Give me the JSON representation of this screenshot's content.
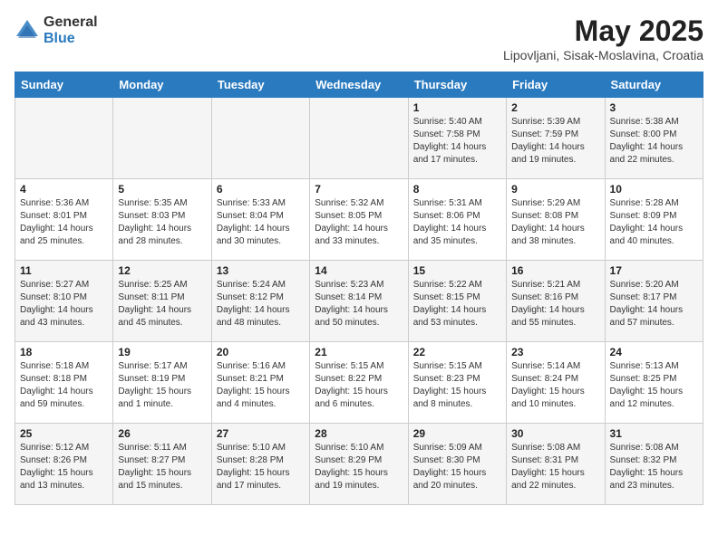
{
  "logo": {
    "general": "General",
    "blue": "Blue"
  },
  "title": "May 2025",
  "subtitle": "Lipovljani, Sisak-Moslavina, Croatia",
  "days_header": [
    "Sunday",
    "Monday",
    "Tuesday",
    "Wednesday",
    "Thursday",
    "Friday",
    "Saturday"
  ],
  "weeks": [
    [
      {
        "num": "",
        "info": ""
      },
      {
        "num": "",
        "info": ""
      },
      {
        "num": "",
        "info": ""
      },
      {
        "num": "",
        "info": ""
      },
      {
        "num": "1",
        "info": "Sunrise: 5:40 AM\nSunset: 7:58 PM\nDaylight: 14 hours\nand 17 minutes."
      },
      {
        "num": "2",
        "info": "Sunrise: 5:39 AM\nSunset: 7:59 PM\nDaylight: 14 hours\nand 19 minutes."
      },
      {
        "num": "3",
        "info": "Sunrise: 5:38 AM\nSunset: 8:00 PM\nDaylight: 14 hours\nand 22 minutes."
      }
    ],
    [
      {
        "num": "4",
        "info": "Sunrise: 5:36 AM\nSunset: 8:01 PM\nDaylight: 14 hours\nand 25 minutes."
      },
      {
        "num": "5",
        "info": "Sunrise: 5:35 AM\nSunset: 8:03 PM\nDaylight: 14 hours\nand 28 minutes."
      },
      {
        "num": "6",
        "info": "Sunrise: 5:33 AM\nSunset: 8:04 PM\nDaylight: 14 hours\nand 30 minutes."
      },
      {
        "num": "7",
        "info": "Sunrise: 5:32 AM\nSunset: 8:05 PM\nDaylight: 14 hours\nand 33 minutes."
      },
      {
        "num": "8",
        "info": "Sunrise: 5:31 AM\nSunset: 8:06 PM\nDaylight: 14 hours\nand 35 minutes."
      },
      {
        "num": "9",
        "info": "Sunrise: 5:29 AM\nSunset: 8:08 PM\nDaylight: 14 hours\nand 38 minutes."
      },
      {
        "num": "10",
        "info": "Sunrise: 5:28 AM\nSunset: 8:09 PM\nDaylight: 14 hours\nand 40 minutes."
      }
    ],
    [
      {
        "num": "11",
        "info": "Sunrise: 5:27 AM\nSunset: 8:10 PM\nDaylight: 14 hours\nand 43 minutes."
      },
      {
        "num": "12",
        "info": "Sunrise: 5:25 AM\nSunset: 8:11 PM\nDaylight: 14 hours\nand 45 minutes."
      },
      {
        "num": "13",
        "info": "Sunrise: 5:24 AM\nSunset: 8:12 PM\nDaylight: 14 hours\nand 48 minutes."
      },
      {
        "num": "14",
        "info": "Sunrise: 5:23 AM\nSunset: 8:14 PM\nDaylight: 14 hours\nand 50 minutes."
      },
      {
        "num": "15",
        "info": "Sunrise: 5:22 AM\nSunset: 8:15 PM\nDaylight: 14 hours\nand 53 minutes."
      },
      {
        "num": "16",
        "info": "Sunrise: 5:21 AM\nSunset: 8:16 PM\nDaylight: 14 hours\nand 55 minutes."
      },
      {
        "num": "17",
        "info": "Sunrise: 5:20 AM\nSunset: 8:17 PM\nDaylight: 14 hours\nand 57 minutes."
      }
    ],
    [
      {
        "num": "18",
        "info": "Sunrise: 5:18 AM\nSunset: 8:18 PM\nDaylight: 14 hours\nand 59 minutes."
      },
      {
        "num": "19",
        "info": "Sunrise: 5:17 AM\nSunset: 8:19 PM\nDaylight: 15 hours\nand 1 minute."
      },
      {
        "num": "20",
        "info": "Sunrise: 5:16 AM\nSunset: 8:21 PM\nDaylight: 15 hours\nand 4 minutes."
      },
      {
        "num": "21",
        "info": "Sunrise: 5:15 AM\nSunset: 8:22 PM\nDaylight: 15 hours\nand 6 minutes."
      },
      {
        "num": "22",
        "info": "Sunrise: 5:15 AM\nSunset: 8:23 PM\nDaylight: 15 hours\nand 8 minutes."
      },
      {
        "num": "23",
        "info": "Sunrise: 5:14 AM\nSunset: 8:24 PM\nDaylight: 15 hours\nand 10 minutes."
      },
      {
        "num": "24",
        "info": "Sunrise: 5:13 AM\nSunset: 8:25 PM\nDaylight: 15 hours\nand 12 minutes."
      }
    ],
    [
      {
        "num": "25",
        "info": "Sunrise: 5:12 AM\nSunset: 8:26 PM\nDaylight: 15 hours\nand 13 minutes."
      },
      {
        "num": "26",
        "info": "Sunrise: 5:11 AM\nSunset: 8:27 PM\nDaylight: 15 hours\nand 15 minutes."
      },
      {
        "num": "27",
        "info": "Sunrise: 5:10 AM\nSunset: 8:28 PM\nDaylight: 15 hours\nand 17 minutes."
      },
      {
        "num": "28",
        "info": "Sunrise: 5:10 AM\nSunset: 8:29 PM\nDaylight: 15 hours\nand 19 minutes."
      },
      {
        "num": "29",
        "info": "Sunrise: 5:09 AM\nSunset: 8:30 PM\nDaylight: 15 hours\nand 20 minutes."
      },
      {
        "num": "30",
        "info": "Sunrise: 5:08 AM\nSunset: 8:31 PM\nDaylight: 15 hours\nand 22 minutes."
      },
      {
        "num": "31",
        "info": "Sunrise: 5:08 AM\nSunset: 8:32 PM\nDaylight: 15 hours\nand 23 minutes."
      }
    ]
  ]
}
